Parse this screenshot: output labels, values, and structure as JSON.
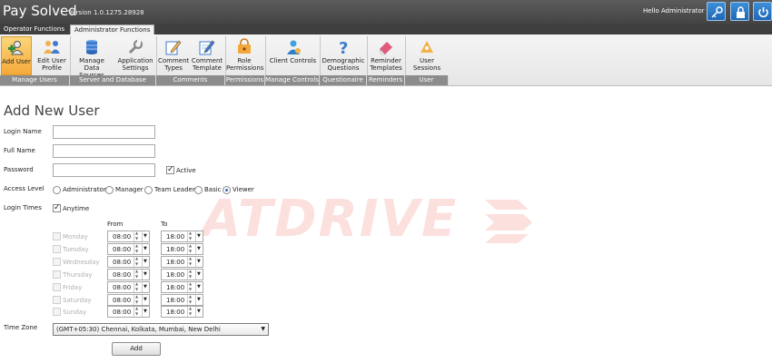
{
  "window": {
    "app_title": "Pay Solved",
    "version": "Version 1.0.1275.28928",
    "greeting": "Hello Administrator",
    "title_icons": [
      "key-icon",
      "lock-icon",
      "power-icon"
    ]
  },
  "ribbon_tabs": [
    "Operator Functions",
    "Administrator Functions"
  ],
  "active_tab": "Administrator Functions",
  "ribbon": {
    "buttons": [
      {
        "label_1": "Add User",
        "label_2": "",
        "icon": "add-user-icon",
        "active": true
      },
      {
        "label_1": "Edit User",
        "label_2": "Profile",
        "icon": "users-icon",
        "active": false
      },
      {
        "label_1": "Manage Data",
        "label_2": "Sources",
        "icon": "database-icon",
        "active": false
      },
      {
        "label_1": "Application",
        "label_2": "Settings",
        "icon": "wrench-icon",
        "active": false
      },
      {
        "label_1": "Comment",
        "label_2": "Types",
        "icon": "pencil-icon",
        "active": false
      },
      {
        "label_1": "Comment",
        "label_2": "Template",
        "icon": "pencil-doc-icon",
        "active": false
      },
      {
        "label_1": "Role",
        "label_2": "Permissions",
        "icon": "permissions-icon",
        "active": false
      },
      {
        "label_1": "Client Controls",
        "label_2": "",
        "icon": "client-icon",
        "active": false
      },
      {
        "label_1": "Demographic",
        "label_2": "Questions",
        "icon": "question-icon",
        "active": false
      },
      {
        "label_1": "Reminder",
        "label_2": "Templates",
        "icon": "eraser-icon",
        "active": false
      },
      {
        "label_1": "User",
        "label_2": "Sessions",
        "icon": "sessions-icon",
        "active": false
      }
    ],
    "groups": [
      "Manage Users",
      "Server and Database",
      "Comments",
      "Permissions",
      "Manage Controls",
      "Questionaire",
      "Reminders",
      "User Sessions"
    ]
  },
  "form": {
    "title": "Add New User",
    "login_name_label": "Login Name",
    "login_name_value": "",
    "full_name_label": "Full Name",
    "full_name_value": "",
    "password_label": "Password",
    "password_value": "",
    "active_label": "Active",
    "active_checked": true,
    "access_level_label": "Access Level",
    "access_levels": [
      "Administrator",
      "Manager",
      "Team Leader",
      "Basic",
      "Viewer"
    ],
    "access_level_selected": "Viewer",
    "login_times_label": "Login Times",
    "anytime_label": "Anytime",
    "anytime_checked": true,
    "from_label": "From",
    "to_label": "To",
    "days": [
      {
        "day": "Monday",
        "from": "08:00",
        "to": "18:00"
      },
      {
        "day": "Tuesday",
        "from": "08:00",
        "to": "18:00"
      },
      {
        "day": "Wednesday",
        "from": "08:00",
        "to": "18:00"
      },
      {
        "day": "Thursday",
        "from": "08:00",
        "to": "18:00"
      },
      {
        "day": "Friday",
        "from": "08:00",
        "to": "18:00"
      },
      {
        "day": "Saturday",
        "from": "08:00",
        "to": "18:00"
      },
      {
        "day": "Sunday",
        "from": "08:00",
        "to": "18:00"
      }
    ],
    "time_zone_label": "Time Zone",
    "time_zone_value": "(GMT+05:30) Chennai, Kolkata, Mumbai, New Delhi",
    "add_button": "Add"
  },
  "watermark": "ATDRIVE",
  "colors": {
    "titlebar": "#4a4a4a",
    "accent_button": "#1e67b5",
    "active_ribbon": "#f6a93a",
    "watermark": "#e63c32"
  }
}
